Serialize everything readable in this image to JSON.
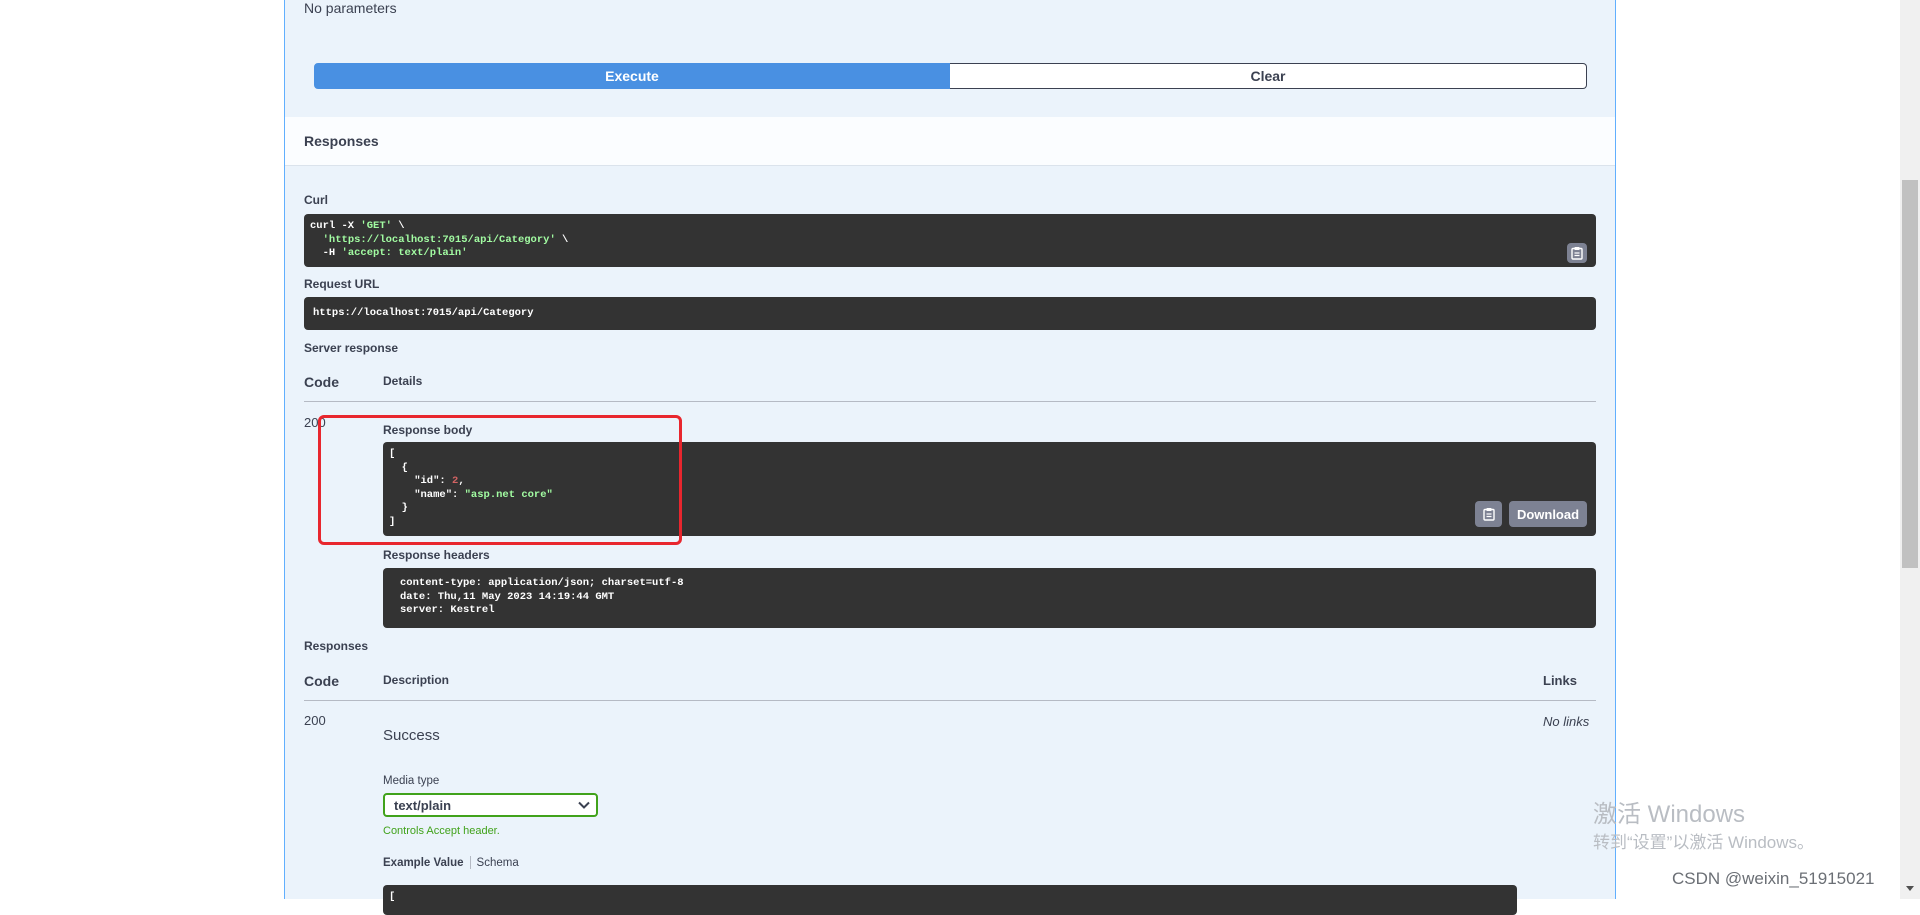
{
  "top": {
    "no_params": "No parameters"
  },
  "buttons": {
    "execute": "Execute",
    "clear": "Clear"
  },
  "responses_header": "Responses",
  "curl": {
    "label": "Curl",
    "line1_pre": "curl -X ",
    "line1_method": "'GET'",
    "line1_post": " \\",
    "line2_url": "'https://localhost:7015/api/Category'",
    "line2_post": " \\",
    "line3_pre": "  -H ",
    "line3_header": "'accept: text/plain'"
  },
  "request_url": {
    "label": "Request URL",
    "value": "https://localhost:7015/api/Category"
  },
  "server_response": {
    "label": "Server response",
    "col_code": "Code",
    "col_details": "Details",
    "code": "200",
    "body_label": "Response body",
    "body": {
      "l1": "[",
      "l2": "  {",
      "id_key": "    \"id\": ",
      "id_val": "2",
      "id_comma": ",",
      "name_key": "    \"name\": ",
      "name_val": "\"asp.net core\"",
      "l5": "  }",
      "l6": "]"
    },
    "download": "Download",
    "headers_label": "Response headers",
    "headers": {
      "h1": "content-type: application/json; charset=utf-8",
      "h2": "date: Thu,11 May 2023 14:19:44 GMT",
      "h3": "server: Kestrel"
    }
  },
  "responses": {
    "label": "Responses",
    "col_code": "Code",
    "col_description": "Description",
    "col_links": "Links",
    "code": "200",
    "description": "Success",
    "links": "No links",
    "media_type_label": "Media type",
    "media_type_value": "text/plain",
    "controls_accept": "Controls Accept header.",
    "example_value": "Example Value",
    "schema": "Schema",
    "example_line1": "["
  },
  "overlay": {
    "watermark_line1": "激活 Windows",
    "watermark_line2": "转到“设置”以激活 Windows。",
    "csdn": "CSDN @weixin_51915021"
  },
  "colors": {
    "execute_blue": "#4990e2",
    "border_blue": "#61affe",
    "code_bg": "#333333",
    "string_green": "#a2fca2",
    "media_border_green": "#41a21b",
    "highlight_red": "#e8262e"
  }
}
